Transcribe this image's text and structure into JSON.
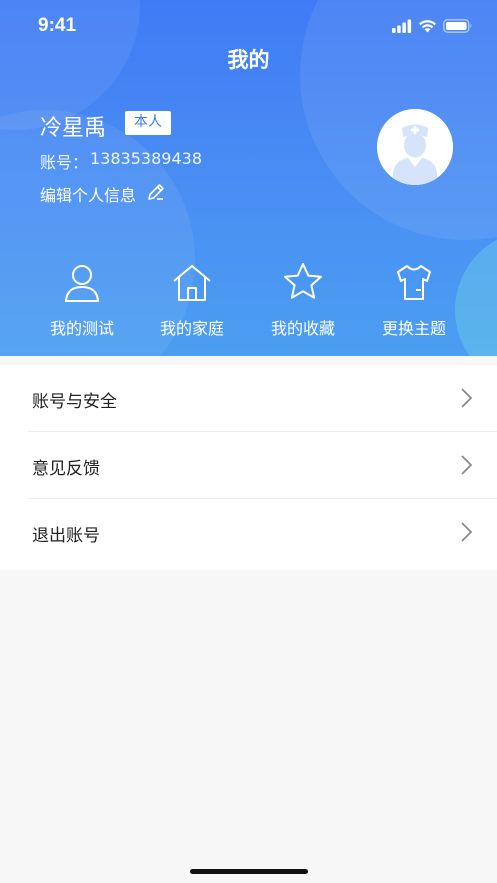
{
  "status_bar": {
    "time": "9:41",
    "icons": [
      "signal-icon",
      "wifi-icon",
      "battery-icon"
    ]
  },
  "header": {
    "title": "我的"
  },
  "profile": {
    "name": "冷星禹",
    "badge": "本人",
    "account_label": "账号：",
    "account_value": "13835389438",
    "edit_label": "编辑个人信息",
    "avatar_icon": "doctor-avatar-icon"
  },
  "menu": {
    "items": [
      {
        "label": "我的测试",
        "icon": "person-icon"
      },
      {
        "label": "我的家庭",
        "icon": "home-icon"
      },
      {
        "label": "我的收藏",
        "icon": "star-icon"
      },
      {
        "label": "更换主题",
        "icon": "shirt-icon"
      }
    ]
  },
  "settings": {
    "items": [
      {
        "label": "账号与安全"
      },
      {
        "label": "意见反馈"
      },
      {
        "label": "退出账号"
      }
    ]
  },
  "colors": {
    "header_gradient_top": "#3f7bf5",
    "header_gradient_bottom": "#4b9ef1",
    "badge_text": "#3b7cf4",
    "page_bg": "#f7f7f7"
  }
}
